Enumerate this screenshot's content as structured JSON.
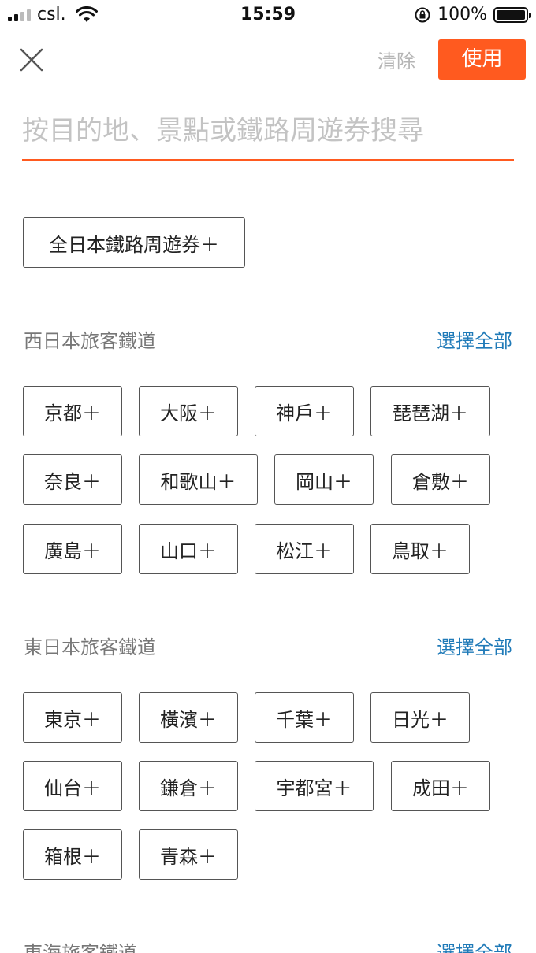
{
  "status_bar": {
    "carrier": "csl.",
    "time": "15:59",
    "battery": "100%",
    "battery_level": 1.0
  },
  "header": {
    "clear_label": "清除",
    "apply_label": "使用"
  },
  "search": {
    "placeholder": "按目的地、景點或鐵路周遊券搜尋"
  },
  "featured_pass": {
    "label": "全日本鐵路周遊券＋"
  },
  "sections": [
    {
      "title": "西日本旅客鐵道",
      "select_all": "選擇全部",
      "items": [
        "京都＋",
        "大阪＋",
        "神戶＋",
        "琵琶湖＋",
        "奈良＋",
        "和歌山＋",
        "岡山＋",
        "倉敷＋",
        "廣島＋",
        "山口＋",
        "松江＋",
        "鳥取＋"
      ]
    },
    {
      "title": "東日本旅客鐵道",
      "select_all": "選擇全部",
      "items": [
        "東京＋",
        "橫濱＋",
        "千葉＋",
        "日光＋",
        "仙台＋",
        "鎌倉＋",
        "宇都宮＋",
        "成田＋",
        "箱根＋",
        "青森＋"
      ]
    },
    {
      "title": "東海旅客鐵道",
      "select_all": "選擇全部"
    }
  ]
}
